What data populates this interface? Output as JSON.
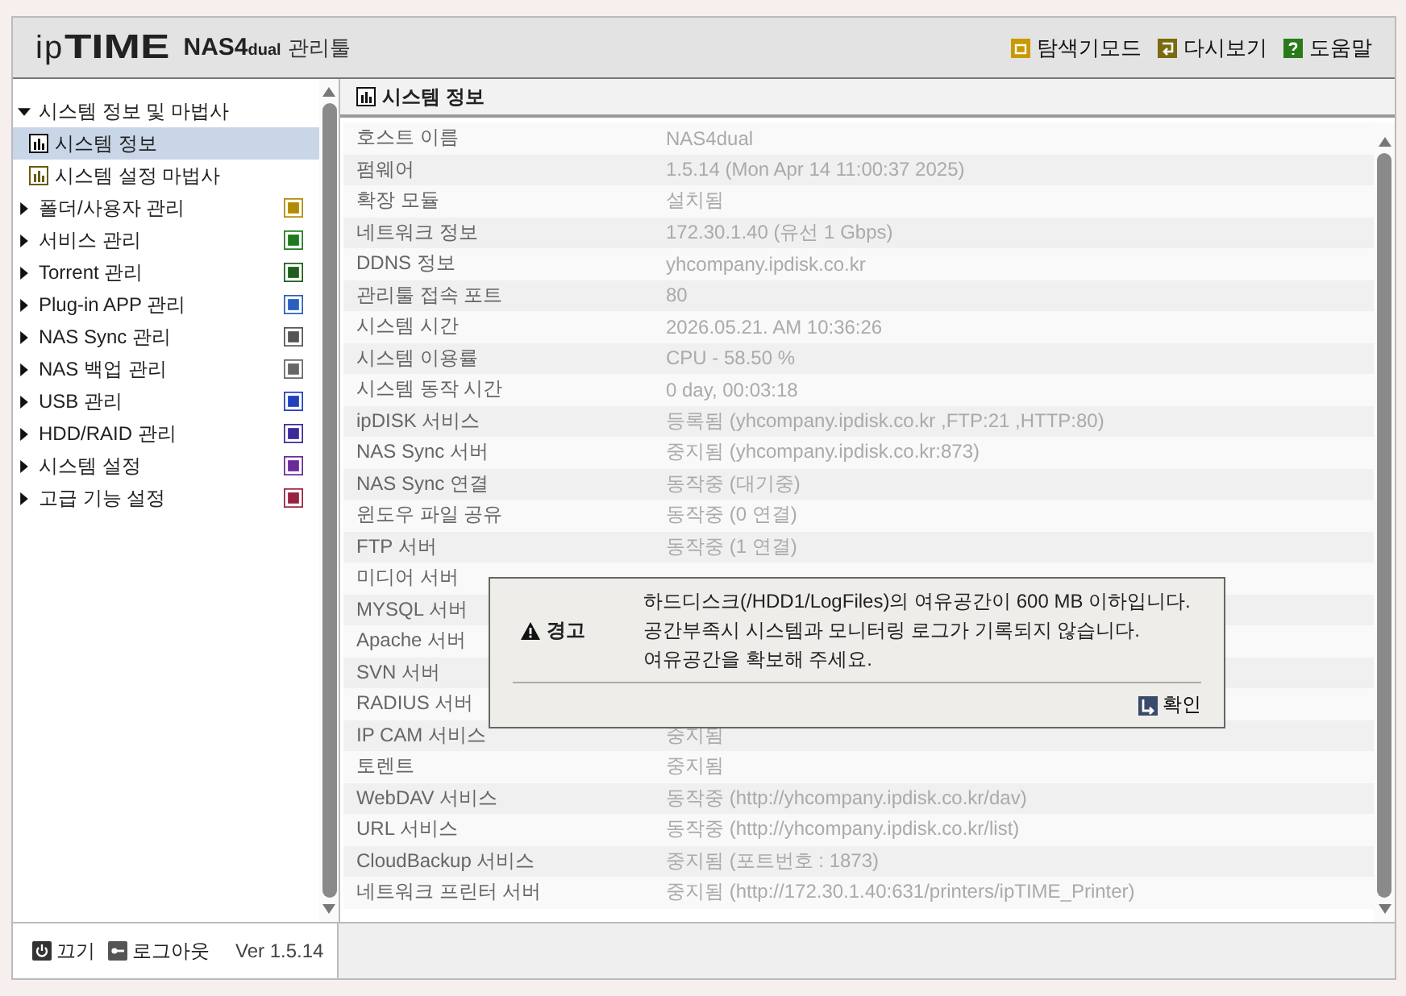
{
  "header": {
    "logo_light": "ip",
    "logo_bold": "TIME",
    "product": "NAS4",
    "product_small": "dual",
    "subtitle": "관리툴",
    "actions": [
      {
        "label": "탐색기모드",
        "kind": "explorer"
      },
      {
        "label": "다시보기",
        "kind": "refresh"
      },
      {
        "label": "도움말",
        "kind": "help"
      }
    ]
  },
  "sidebar": {
    "items": [
      {
        "label": "시스템 정보 및 마법사",
        "expanded": true,
        "children": [
          {
            "label": "시스템 정보",
            "selected": true
          },
          {
            "label": "시스템 설정 마법사",
            "selected": false
          }
        ]
      },
      {
        "label": "폴더/사용자 관리",
        "expanded": false,
        "color": "#b08a00"
      },
      {
        "label": "서비스 관리",
        "expanded": false,
        "color": "#1e7a1e"
      },
      {
        "label": "Torrent 관리",
        "expanded": false,
        "color": "#1e5e1e"
      },
      {
        "label": "Plug-in APP 관리",
        "expanded": false,
        "color": "#2a5fc0"
      },
      {
        "label": "NAS Sync 관리",
        "expanded": false,
        "color": "#555555"
      },
      {
        "label": "NAS 백업 관리",
        "expanded": false,
        "color": "#666666"
      },
      {
        "label": "USB 관리",
        "expanded": false,
        "color": "#2040c0"
      },
      {
        "label": "HDD/RAID 관리",
        "expanded": false,
        "color": "#3a2a9a"
      },
      {
        "label": "시스템 설정",
        "expanded": false,
        "color": "#6a2a9a"
      },
      {
        "label": "고급 기능 설정",
        "expanded": false,
        "color": "#9a2040"
      }
    ],
    "footer": {
      "power": "끄기",
      "logout": "로그아웃",
      "version": "Ver 1.5.14"
    }
  },
  "panel": {
    "title": "시스템 정보",
    "rows": [
      {
        "label": "호스트 이름",
        "value": "NAS4dual"
      },
      {
        "label": "펌웨어",
        "value": "1.5.14 (Mon Apr 14 11:00:37 2025)"
      },
      {
        "label": "확장 모듈",
        "value": "설치됨"
      },
      {
        "label": "네트워크 정보",
        "value": "172.30.1.40 (유선 1 Gbps)"
      },
      {
        "label": "DDNS 정보",
        "value": "yhcompany.ipdisk.co.kr"
      },
      {
        "label": "관리툴 접속 포트",
        "value": "80"
      },
      {
        "label": "시스템 시간",
        "value": "2026.05.21. AM 10:36:26"
      },
      {
        "label": "시스템 이용률",
        "value": "CPU - 58.50 %"
      },
      {
        "label": "시스템 동작 시간",
        "value": "0 day, 00:03:18"
      },
      {
        "label": "ipDISK 서비스",
        "value": "등록됨 (yhcompany.ipdisk.co.kr ,FTP:21 ,HTTP:80)"
      },
      {
        "label": "NAS Sync 서버",
        "value": "중지됨 (yhcompany.ipdisk.co.kr:873)"
      },
      {
        "label": "NAS Sync 연결",
        "value": "동작중 (대기중)"
      },
      {
        "label": "윈도우 파일 공유",
        "value": "동작중 (0 연결)"
      },
      {
        "label": "FTP 서버",
        "value": "동작중 (1 연결)"
      },
      {
        "label": "미디어 서버"
      },
      {
        "label": "MYSQL 서버"
      },
      {
        "label": "Apache 서버"
      },
      {
        "label": "SVN 서버"
      },
      {
        "label": "RADIUS 서버"
      },
      {
        "label": "IP CAM 서비스",
        "value": "중지됨"
      },
      {
        "label": "토렌트",
        "value": "중지됨"
      },
      {
        "label": "WebDAV 서비스",
        "value": "동작중 (http://yhcompany.ipdisk.co.kr/dav)"
      },
      {
        "label": "URL 서비스",
        "value": "동작중 (http://yhcompany.ipdisk.co.kr/list)"
      },
      {
        "label": "CloudBackup 서비스",
        "value": "중지됨 (포트번호 : 1873)"
      },
      {
        "label": "네트워크 프린터 서버",
        "value": "중지됨 (http://172.30.1.40:631/printers/ipTIME_Printer)"
      }
    ]
  },
  "dialog": {
    "title": "경고",
    "lines": [
      "하드디스크(/HDD1/LogFiles)의 여유공간이 600 MB 이하입니다.",
      "공간부족시 시스템과 모니터링 로그가 기록되지 않습니다.",
      "여유공간을 확보해 주세요."
    ],
    "button": "확인"
  }
}
